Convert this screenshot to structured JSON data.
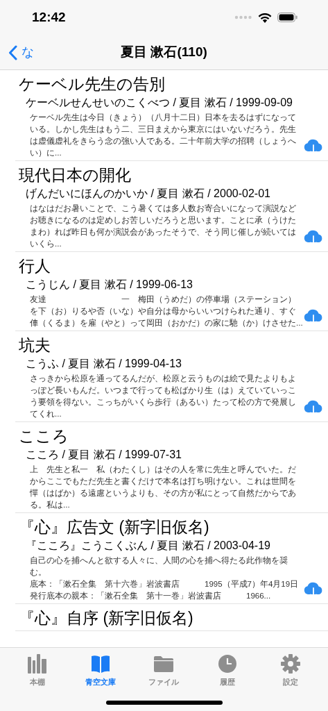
{
  "status_bar": {
    "time": "12:42"
  },
  "nav": {
    "back": "な",
    "title": "夏目 漱石(110)"
  },
  "works": [
    {
      "title": "ケーベル先生の告別",
      "subtitle": "ケーベルせんせいのこくべつ / 夏目 漱石 / 1999-09-09",
      "summary": "ケーベル先生は今日（きょう）（八月十二日）日本を去るはずになっている。しかし先生はもう二、三日まえから東京にはいないだろう。先生は虚儀虚礼をきらう念の強い人である。二十年前大学の招聘（しょうへい）に...",
      "downloadable": true
    },
    {
      "title": "現代日本の開化",
      "subtitle": "げんだいにほんのかいか / 夏目 漱石 / 2000-02-01",
      "summary": "はなはだお暑いことで、こう暑くては多人数お寄合いになって演説などお聴きになるのは定めしお苦しいだろうと思います。ことに承（うけたまわ）れば昨日も何か演説会があったそうで、そう同じ催しが続いてはいくら...",
      "downloadable": true
    },
    {
      "title": "行人",
      "subtitle": "こうじん / 夏目 漱石 / 1999-06-13",
      "summary": "友達　　　　　　　　　一　梅田（うめだ）の停車場（ステーション）を下（お）りるや否（いな）や自分は母からいいつけられた通り、すぐ俥（くるま）を雇（やと）って岡田（おかだ）の家に馳（か）けさせた...",
      "downloadable": true
    },
    {
      "title": "坑夫",
      "subtitle": "こうふ / 夏目 漱石 / 1999-04-13",
      "summary": "さっきから松原を通ってるんだが、松原と云うものは絵で見たよりもよっぽど長いもんだ。いつまで行っても松ばかり生（は）えていていっこう要領を得ない。こっちがいくら歩行（あるい）たって松の方で発展してくれ...",
      "downloadable": true
    },
    {
      "title": "こころ",
      "subtitle": "こころ / 夏目 漱石 / 1999-07-31",
      "summary": "上　先生と私一　私（わたくし）はその人を常に先生と呼んでいた。だからここでもただ先生と書くだけで本名は打ち明けない。これは世間を憚（はばか）る遠慮というよりも、その方が私にとって自然だからである。私は...",
      "downloadable": false
    },
    {
      "title": "『心』広告文 (新字旧仮名)",
      "subtitle": "『こころ』こうこくぶん / 夏目 漱石 / 2003-04-19",
      "summary": [
        "自己の心を捕へんと欲する人々に、人間の心を捕へ得たる此作物を奨む。",
        "底本：「漱石全集　第十六巻」岩波書店　　　1995（平成7）年4月19日",
        "発行底本の親本：「漱石全集　第十一巻」岩波書店　　　1966..."
      ],
      "downloadable": true
    },
    {
      "title": "『心』自序 (新字旧仮名)"
    }
  ],
  "tabs": [
    {
      "kind": "shelf",
      "label": "本棚",
      "selected": false
    },
    {
      "kind": "book",
      "label": "青空文庫",
      "selected": true
    },
    {
      "kind": "folder",
      "label": "ファイル",
      "selected": false
    },
    {
      "kind": "clock",
      "label": "履歴",
      "selected": false
    },
    {
      "kind": "gear",
      "label": "設定",
      "selected": false
    }
  ]
}
